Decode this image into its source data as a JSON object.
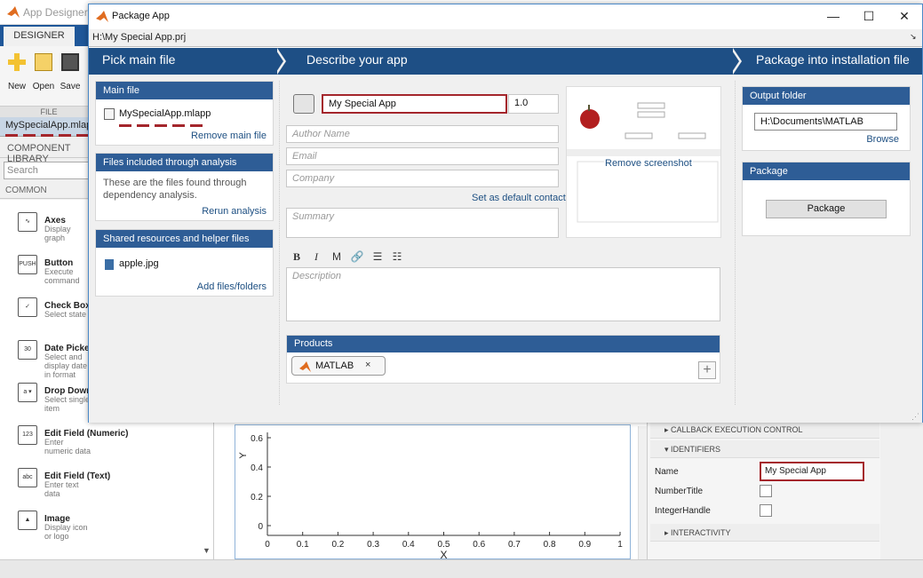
{
  "app_title": "App Designer - H:\\My Special App.mlapp",
  "background": {
    "designer_tab": "DESIGNER",
    "toolbar": {
      "new": "New",
      "open": "Open",
      "save": "Save"
    },
    "file_section": "FILE",
    "open_file": "MySpecialApp.mlapp",
    "component_library": "COMPONENT LIBRARY",
    "search_placeholder": "Search",
    "common": "COMMON",
    "components": [
      {
        "name": "Axes",
        "desc": "Display graph",
        "icon": "axes-icon",
        "glyph": "∿"
      },
      {
        "name": "Button",
        "desc": "Execute command",
        "icon": "push-button-icon",
        "glyph": "PUSH"
      },
      {
        "name": "Check Box",
        "desc": "Select state",
        "icon": "checkbox-icon",
        "glyph": "✓"
      },
      {
        "name": "Date Picker",
        "desc": "Select and display date in format",
        "icon": "calendar-icon",
        "glyph": "30"
      },
      {
        "name": "Drop Down",
        "desc": "Select single item",
        "icon": "dropdown-icon",
        "glyph": "a ▾"
      },
      {
        "name": "Edit Field (Numeric)",
        "desc": "Enter numeric data",
        "icon": "numeric-field-icon",
        "glyph": "123"
      },
      {
        "name": "Edit Field (Text)",
        "desc": "Enter text data",
        "icon": "text-field-icon",
        "glyph": "abc"
      },
      {
        "name": "Image",
        "desc": "Display icon or logo",
        "icon": "image-icon",
        "glyph": "▲"
      }
    ],
    "axes": {
      "ylabel": "Y",
      "xlabel": "X",
      "yticks": [
        "0.6",
        "0.4",
        "0.2",
        "0"
      ],
      "xticks": [
        "0",
        "0.1",
        "0.2",
        "0.3",
        "0.4",
        "0.5",
        "0.6",
        "0.7",
        "0.8",
        "0.9",
        "1"
      ]
    },
    "inspector": {
      "callback_section": "CALLBACK EXECUTION CONTROL",
      "identifiers_section": "IDENTIFIERS",
      "name_label": "Name",
      "name_value": "My Special App",
      "number_title_label": "NumberTitle",
      "integer_handle_label": "IntegerHandle",
      "interactivity_section": "INTERACTIVITY"
    }
  },
  "dialog": {
    "title": "Package App",
    "project_path": "H:\\My Special App.prj",
    "steps": [
      "Pick main file",
      "Describe your app",
      "Package into installation file"
    ],
    "main_file": {
      "header": "Main file",
      "file": "MySpecialApp.mlapp",
      "remove_link": "Remove main file"
    },
    "included_files": {
      "header": "Files included through analysis",
      "text": "These are the files found through dependency analysis.",
      "rerun_link": "Rerun analysis"
    },
    "shared_resources": {
      "header": "Shared resources and helper files",
      "file": "apple.jpg",
      "add_link": "Add files/folders"
    },
    "describe": {
      "app_name": "My Special App",
      "version": "1.0",
      "author_placeholder": "Author Name",
      "email_placeholder": "Email",
      "company_placeholder": "Company",
      "default_contact_link": "Set as default contact",
      "summary_placeholder": "Summary",
      "description_placeholder": "Description",
      "remove_screenshot_link": "Remove screenshot",
      "format_buttons": [
        "B",
        "I",
        "M",
        "🔗",
        "☰",
        "☷"
      ],
      "products_header": "Products",
      "product_chip": "MATLAB",
      "chip_close": "×",
      "add_product": "+"
    },
    "package": {
      "output_header": "Output folder",
      "output_path": "H:\\Documents\\MATLAB",
      "browse_link": "Browse",
      "package_header": "Package",
      "package_button": "Package"
    },
    "window_controls": {
      "minimize": "—",
      "maximize": "☐",
      "close": "✕"
    }
  },
  "colors": {
    "accent": "#1e4f85",
    "panel_header": "#2e5d96",
    "highlight_red": "#a4262c",
    "link": "#1d4f82"
  }
}
